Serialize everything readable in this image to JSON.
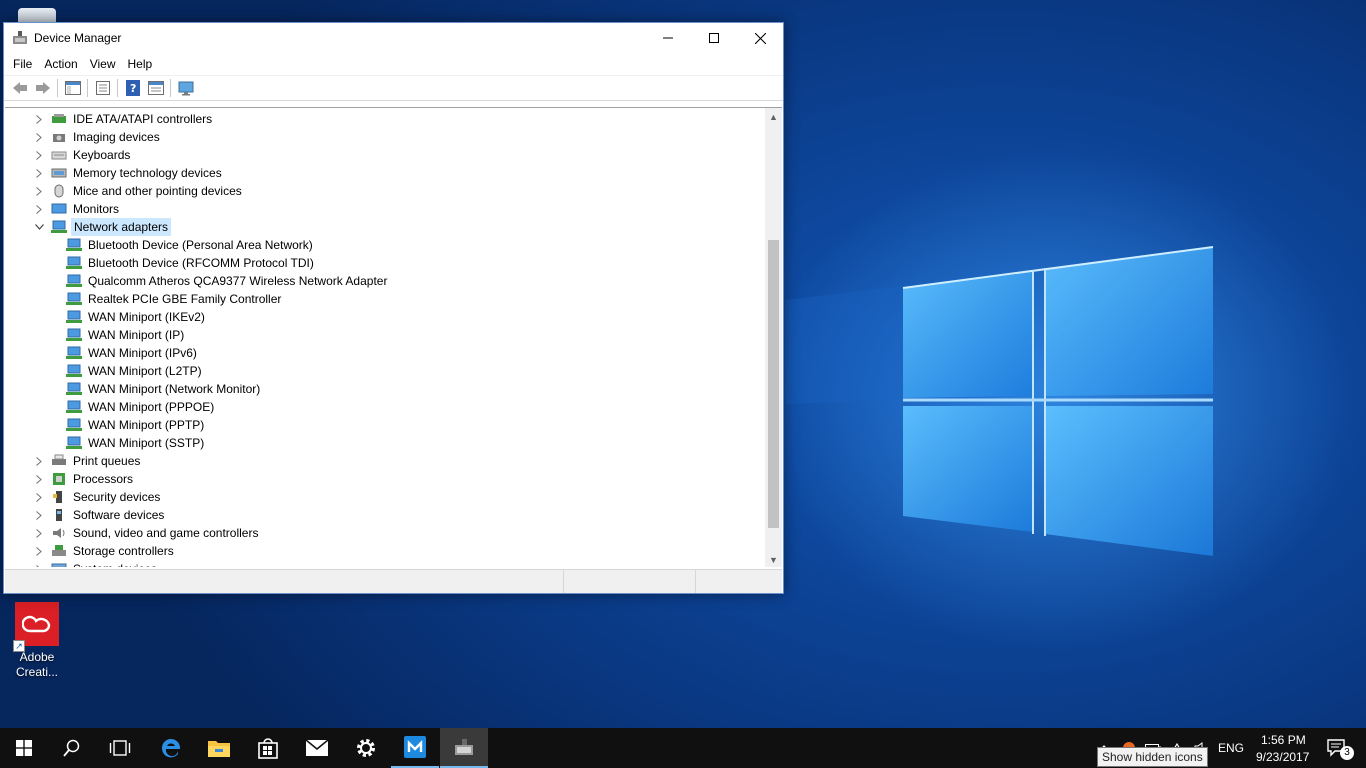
{
  "window": {
    "title": "Device Manager",
    "menu": [
      "File",
      "Action",
      "View",
      "Help"
    ]
  },
  "tree": {
    "categories_before": [
      {
        "label": "IDE ATA/ATAPI controllers",
        "icon": "ide-controller-icon"
      },
      {
        "label": "Imaging devices",
        "icon": "camera-icon"
      },
      {
        "label": "Keyboards",
        "icon": "keyboard-icon"
      },
      {
        "label": "Memory technology devices",
        "icon": "memory-icon"
      },
      {
        "label": "Mice and other pointing devices",
        "icon": "mouse-icon"
      },
      {
        "label": "Monitors",
        "icon": "monitor-icon"
      }
    ],
    "expanded_category": {
      "label": "Network adapters",
      "icon": "network-adapter-icon"
    },
    "network_adapters": [
      "Bluetooth Device (Personal Area Network)",
      "Bluetooth Device (RFCOMM Protocol TDI)",
      "Qualcomm Atheros QCA9377 Wireless Network Adapter",
      "Realtek PCIe GBE Family Controller",
      "WAN Miniport (IKEv2)",
      "WAN Miniport (IP)",
      "WAN Miniport (IPv6)",
      "WAN Miniport (L2TP)",
      "WAN Miniport (Network Monitor)",
      "WAN Miniport (PPPOE)",
      "WAN Miniport (PPTP)",
      "WAN Miniport (SSTP)"
    ],
    "categories_after": [
      {
        "label": "Print queues",
        "icon": "printer-icon"
      },
      {
        "label": "Processors",
        "icon": "processor-icon"
      },
      {
        "label": "Security devices",
        "icon": "security-device-icon"
      },
      {
        "label": "Software devices",
        "icon": "software-device-icon"
      },
      {
        "label": "Sound, video and game controllers",
        "icon": "speaker-icon"
      },
      {
        "label": "Storage controllers",
        "icon": "storage-controller-icon"
      },
      {
        "label": "System devices",
        "icon": "system-device-icon"
      }
    ]
  },
  "desktop": {
    "shortcut_label_line1": "Adobe",
    "shortcut_label_line2": "Creati..."
  },
  "taskbar": {
    "language": "ENG",
    "time": "1:56 PM",
    "date": "9/23/2017",
    "notification_count": "3",
    "tooltip": "Show hidden icons"
  },
  "colors": {
    "accent": "#0078d7",
    "selection": "#cce8ff",
    "taskbar": "#101010"
  }
}
